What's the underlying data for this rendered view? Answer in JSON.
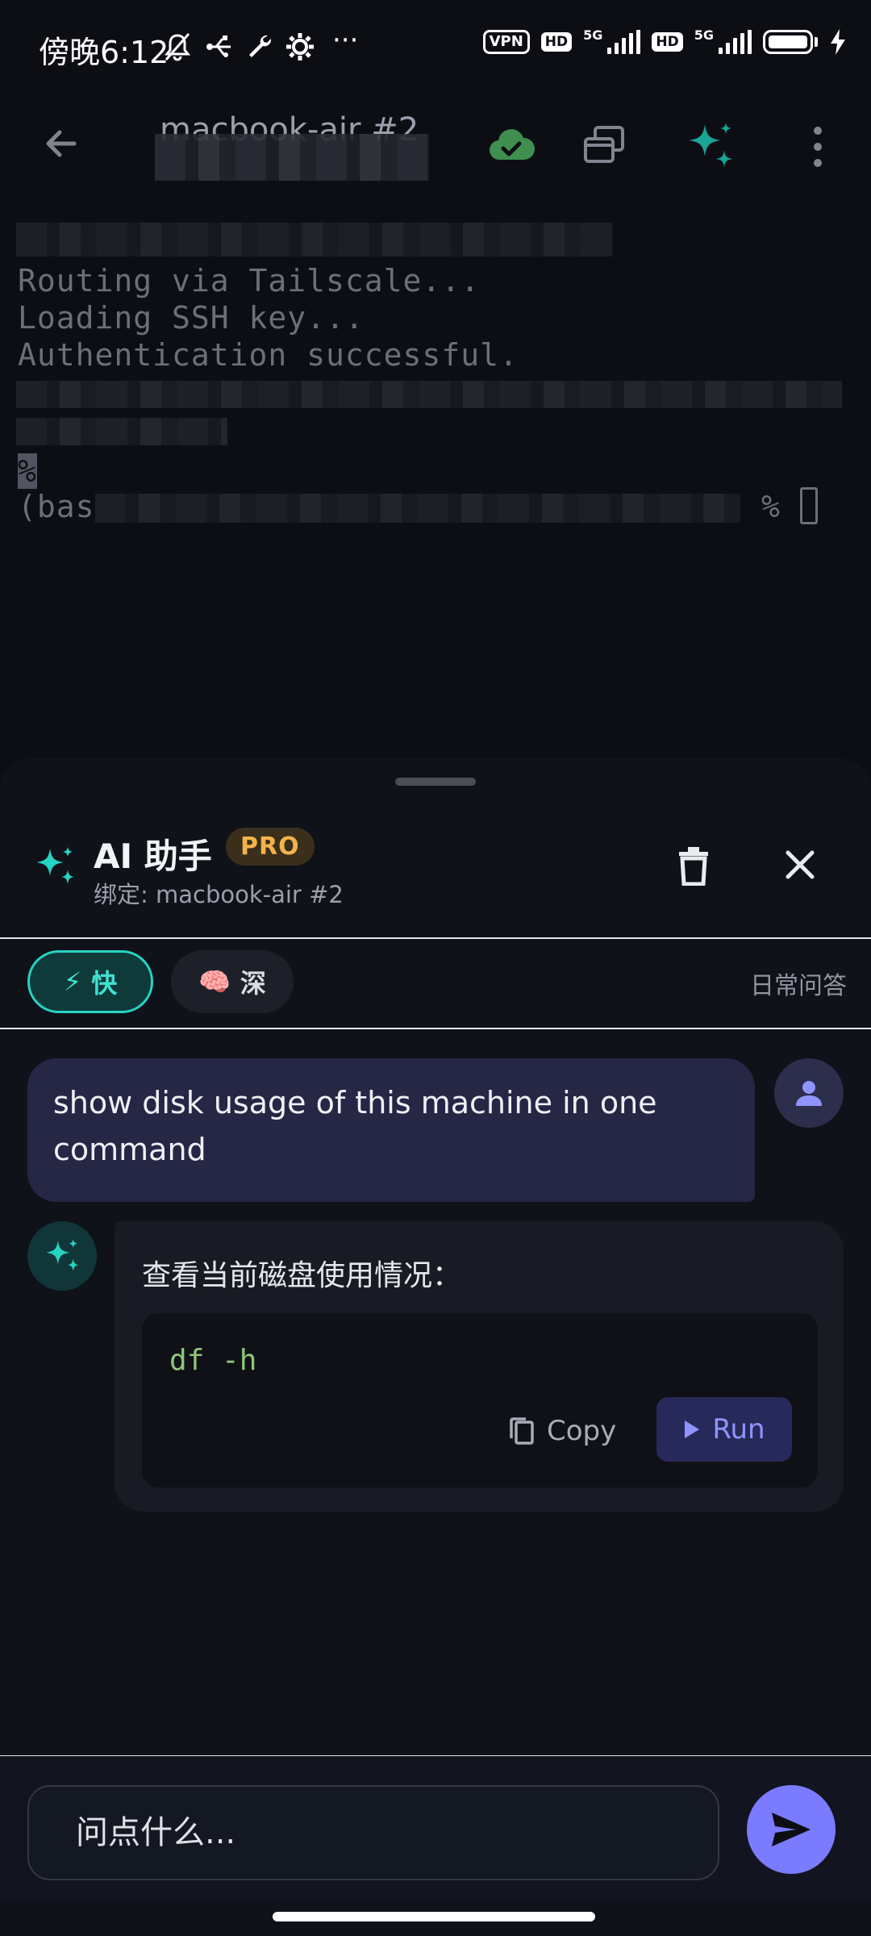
{
  "status_bar": {
    "time": "傍晚6:12",
    "more": "···",
    "vpn": "VPN",
    "hd": "HD",
    "network": "5G"
  },
  "app_bar": {
    "title": "macbook-air #2"
  },
  "terminal": {
    "lines": [
      "Routing via Tailscale...",
      "Loading SSH key...",
      "Authentication successful."
    ],
    "prompt_prefix": "(bas",
    "prompt_char": "%",
    "prompt_tail": "%"
  },
  "assistant": {
    "title": "AI 助手",
    "badge": "PRO",
    "binding": "绑定: macbook-air #2",
    "modes": [
      {
        "icon": "⚡",
        "label": "快",
        "active": true
      },
      {
        "icon": "🧠",
        "label": "深",
        "active": false
      }
    ],
    "mode_description": "日常问答",
    "messages": {
      "user": "show disk usage of this machine in one command",
      "ai_text": "查看当前磁盘使用情况：",
      "code": "df -h",
      "copy_label": "Copy",
      "run_label": "Run"
    },
    "input_placeholder": "问点什么..."
  },
  "colors": {
    "accent_teal": "#27d3c3",
    "accent_purple": "#7b7bff",
    "pro_gold": "#f3b24a",
    "cloud_green": "#3f8f4f"
  },
  "icons": {
    "back": "arrow-left-icon",
    "cloud": "cloud-check-icon",
    "windows": "windows-stack-icon",
    "ai": "sparkle-icon",
    "menu": "more-vertical-icon",
    "delete": "trash-icon",
    "close": "close-icon",
    "user": "person-icon",
    "copy": "copy-icon",
    "run": "play-icon",
    "send": "send-icon"
  }
}
